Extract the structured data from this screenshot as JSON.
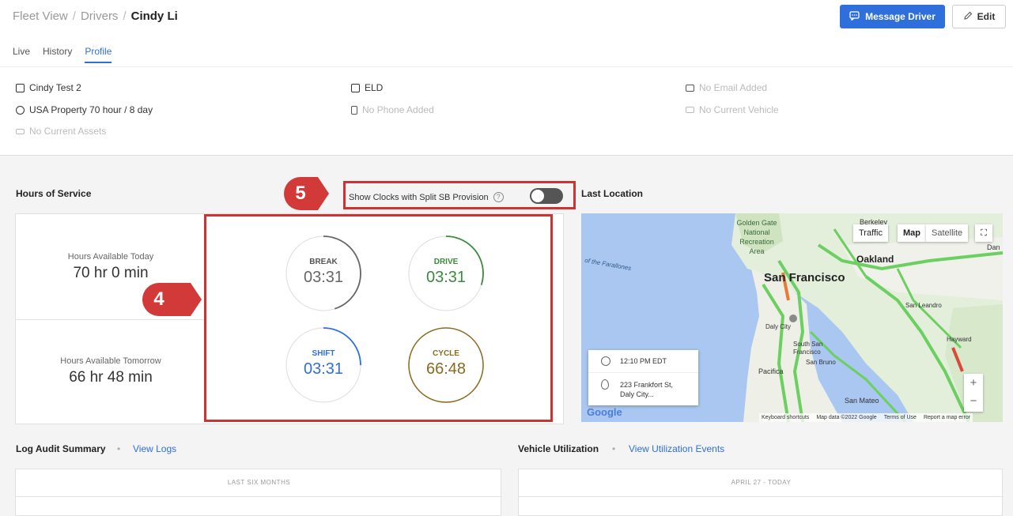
{
  "breadcrumb": {
    "root": "Fleet View",
    "section": "Drivers",
    "current": "Cindy Li"
  },
  "actions": {
    "message": "Message Driver",
    "edit": "Edit"
  },
  "tabs": [
    "Live",
    "History",
    "Profile"
  ],
  "active_tab": "Profile",
  "profile": {
    "name": "Cindy Test 2",
    "ruleset": "USA Property 70 hour / 8 day",
    "assets": "No Current Assets",
    "log_type": "ELD",
    "phone": "No Phone Added",
    "email": "No Email Added",
    "vehicle": "No Current Vehicle"
  },
  "hos": {
    "title": "Hours of Service",
    "toggle_label": "Show Clocks with Split SB Provision",
    "toggle_on": false,
    "today_label": "Hours Available Today",
    "today_value": "70 hr 0 min",
    "tomorrow_label": "Hours Available Tomorrow",
    "tomorrow_value": "66 hr 48 min",
    "clocks": [
      {
        "label": "BREAK",
        "time": "03:31",
        "color": "#666666",
        "fraction": 0.45
      },
      {
        "label": "DRIVE",
        "time": "03:31",
        "color": "#3a8a3a",
        "fraction": 0.3
      },
      {
        "label": "SHIFT",
        "time": "03:31",
        "color": "#2f6fdc",
        "fraction": 0.25
      },
      {
        "label": "CYCLE",
        "time": "66:48",
        "color": "#8a6a1e",
        "fraction": 1.0
      }
    ]
  },
  "callouts": [
    "5",
    "4"
  ],
  "location": {
    "title": "Last Location",
    "map_controls": {
      "traffic": "Traffic",
      "map": "Map",
      "satellite": "Satellite"
    },
    "time": "12:10 PM EDT",
    "address_line1": "223 Frankfort St,",
    "address_line2": "Daly City...",
    "map_labels": {
      "sf": "San Francisco",
      "oakland": "Oakland",
      "berkeley": "Berkeley",
      "ggnra": "Golden Gate National Recreation Area",
      "farallones": "of the Farallones",
      "daly": "Daly City",
      "ssf": "South San Francisco",
      "sanbruno": "San Bruno",
      "pacifica": "Pacifica",
      "sanleandro": "San Leandro",
      "hayward": "Hayward",
      "sanmateo": "San Mateo",
      "dan": "Dan"
    },
    "attribution": {
      "google": "Google",
      "shortcuts": "Keyboard shortcuts",
      "mapdata": "Map data ©2022 Google",
      "terms": "Terms of Use",
      "report": "Report a map error"
    }
  },
  "log_audit": {
    "title": "Log Audit Summary",
    "link": "View Logs",
    "range": "LAST SIX MONTHS"
  },
  "vehicle_util": {
    "title": "Vehicle Utilization",
    "link": "View Utilization Events",
    "range_start": "APRIL 27",
    "range_sep": "-",
    "range_end": "TODAY"
  }
}
